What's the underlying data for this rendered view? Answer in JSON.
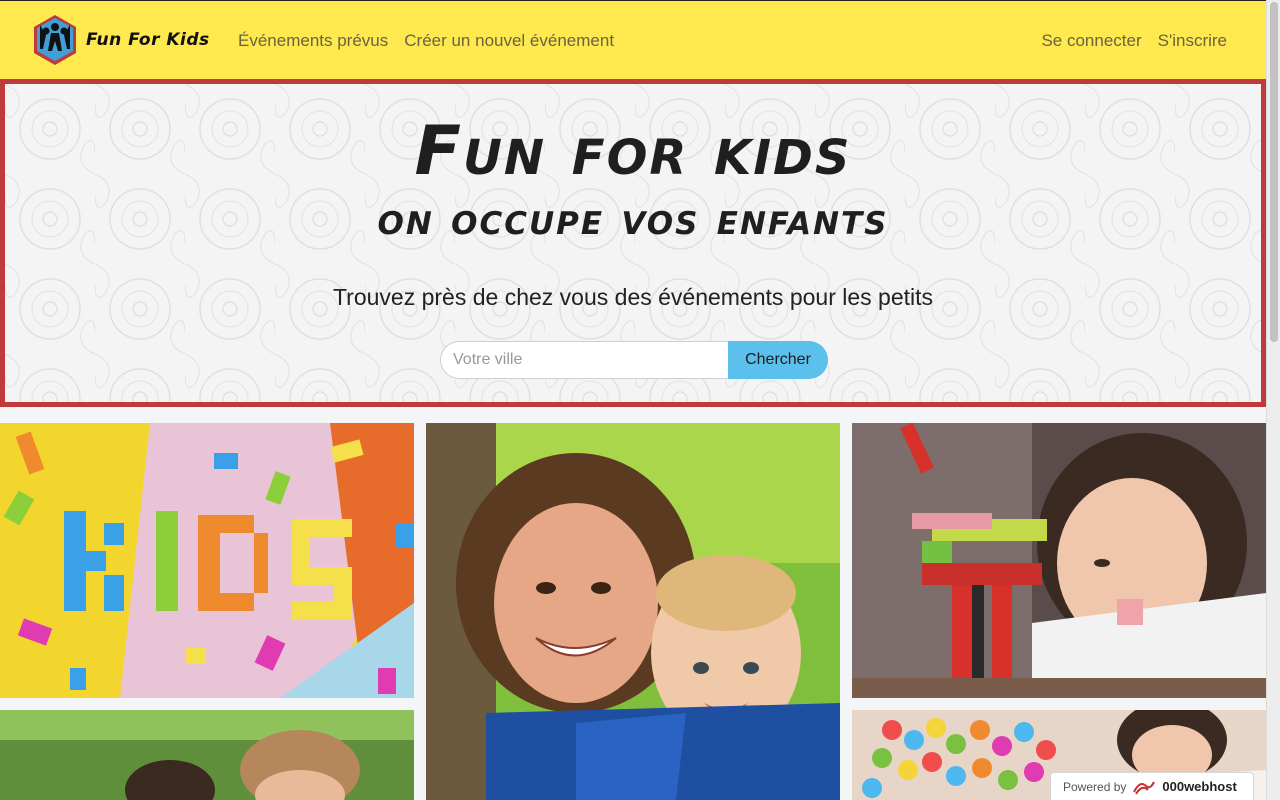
{
  "navbar": {
    "brand": "Fun For Kids",
    "links_left": [
      "Événements prévus",
      "Créer un nouvel événement"
    ],
    "links_right": [
      "Se connecter",
      "S'inscrire"
    ]
  },
  "hero": {
    "title": "Fun for kids",
    "subtitle": "on occupe vos enfants",
    "tagline": "Trouvez près de chez vous des événements pour les petits",
    "search": {
      "placeholder": "Votre ville",
      "value": "",
      "button_label": "Chercher"
    }
  },
  "gallery": {
    "tiles": [
      {
        "icon": "lego-kids-photo",
        "text": "KIDS"
      },
      {
        "icon": "mother-baby-photo"
      },
      {
        "icon": "child-blocks-photo"
      },
      {
        "icon": "children-outdoor-photo"
      },
      {
        "icon": "ball-pit-photo"
      }
    ]
  },
  "badge": {
    "powered_by": "Powered by",
    "host": "000webhost"
  },
  "colors": {
    "navbar": "#ffe94f",
    "hero_border": "#c0393b",
    "search_button": "#5bc0eb"
  }
}
